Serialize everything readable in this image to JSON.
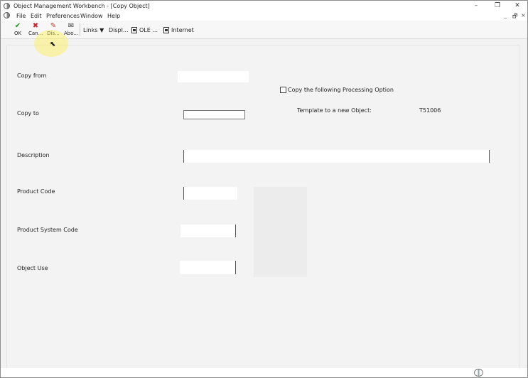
{
  "window": {
    "title": "Object Management Workbench - [Copy Object]"
  },
  "window_controls": {
    "minimize": "–",
    "restore": "❐",
    "close": "✕",
    "doc_minimize": "_",
    "doc_restore": "🗗",
    "doc_close": "×"
  },
  "menu": {
    "items": [
      "File",
      "Edit",
      "Preferences",
      "Window",
      "Help"
    ]
  },
  "toolbar": {
    "ok": {
      "label": "OK",
      "icon": "check-icon",
      "color": "#1f8f1f"
    },
    "cancel": {
      "label": "Can...",
      "icon": "x-icon",
      "color": "#d0202a"
    },
    "display": {
      "label": "Dis...",
      "icon": "eraser-icon"
    },
    "about": {
      "label": "Abo...",
      "icon": "about-icon"
    },
    "links": "Links",
    "links_arrow": "▼",
    "display_menu": "Displ...",
    "ole": "OLE ...",
    "internet": "Internet"
  },
  "form": {
    "copy_from": {
      "label": "Copy from",
      "value": ""
    },
    "copy_processing_option": {
      "label": "Copy the following Processing Option",
      "checked": false
    },
    "copy_to": {
      "label": "Copy to",
      "value": ""
    },
    "template": {
      "label": "Template to a new Object:",
      "value": "T51006"
    },
    "description": {
      "label": "Description",
      "value": ""
    },
    "product_code": {
      "label": "Product Code",
      "value": ""
    },
    "product_system_code": {
      "label": "Product System Code",
      "value": ""
    },
    "object_use": {
      "label": "Object Use",
      "value": ""
    }
  },
  "status": {
    "icon": "globe-icon"
  }
}
